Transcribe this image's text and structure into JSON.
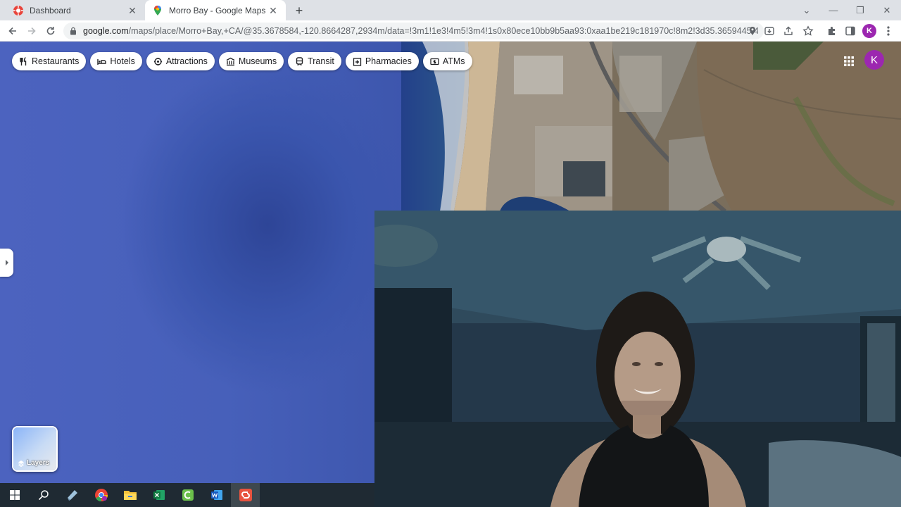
{
  "browser": {
    "tabs": [
      {
        "title": "Dashboard",
        "icon": "dashboard-favicon",
        "active": false
      },
      {
        "title": "Morro Bay - Google Maps",
        "icon": "google-maps-favicon",
        "active": true
      }
    ],
    "url_host": "google.com",
    "url_path": "/maps/place/Morro+Bay,+CA/@35.3678584,-120.8664287,2934m/data=!3m1!1e3!4m5!3m4!1s0x80ece10bb9b5aa93:0xaa1be219c181970c!8m2!3d35.3659445!4d-120.8...",
    "profile_initial": "K"
  },
  "map": {
    "chips": [
      {
        "label": "Restaurants",
        "icon": "restaurant-icon"
      },
      {
        "label": "Hotels",
        "icon": "hotel-icon"
      },
      {
        "label": "Attractions",
        "icon": "attractions-icon"
      },
      {
        "label": "Museums",
        "icon": "museum-icon"
      },
      {
        "label": "Transit",
        "icon": "transit-icon"
      },
      {
        "label": "Pharmacies",
        "icon": "pharmacy-icon"
      },
      {
        "label": "ATMs",
        "icon": "atm-icon"
      }
    ],
    "layers_label": "Layers",
    "account_initial": "K",
    "view": "satellite"
  },
  "taskbar": {
    "items": [
      "windows-start-icon",
      "search-icon",
      "app-icon",
      "chrome-icon",
      "file-explorer-icon",
      "excel-icon",
      "camtasia-icon",
      "word-icon",
      "snagit-icon"
    ]
  },
  "colors": {
    "ocean": "#4760ba",
    "profile": "#9c27b0",
    "taskbar": "#1f2a33"
  }
}
